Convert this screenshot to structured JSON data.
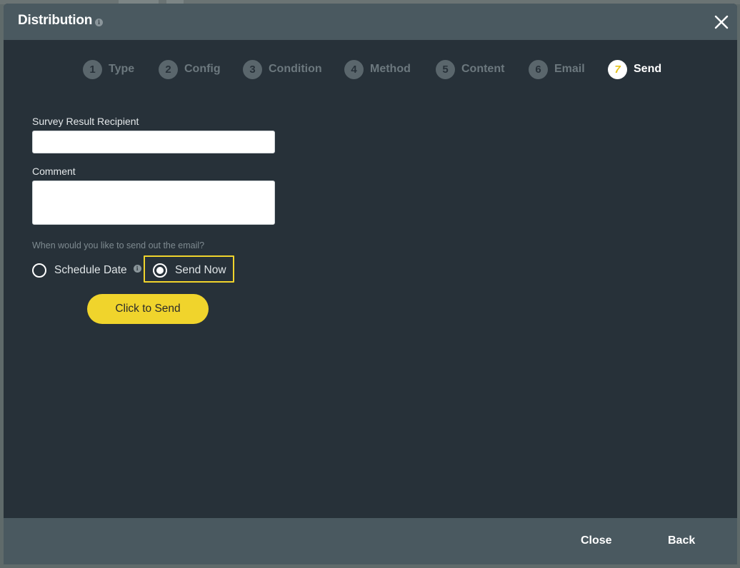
{
  "dialog": {
    "title": "Distribution",
    "title_info_icon": "info-icon",
    "close_icon": "close-icon"
  },
  "steps": [
    {
      "num": "1",
      "label": "Type",
      "active": false
    },
    {
      "num": "2",
      "label": "Config",
      "active": false
    },
    {
      "num": "3",
      "label": "Condition",
      "active": false
    },
    {
      "num": "4",
      "label": "Method",
      "active": false
    },
    {
      "num": "5",
      "label": "Content",
      "active": false
    },
    {
      "num": "6",
      "label": "Email",
      "active": false
    },
    {
      "num": "7",
      "label": "Send",
      "active": true
    }
  ],
  "form": {
    "recipient_label": "Survey Result Recipient",
    "recipient_value": "",
    "comment_label": "Comment",
    "comment_value": "",
    "question": "When would you like to send out the email?",
    "options": [
      {
        "label": "Schedule Date",
        "selected": false,
        "has_info": true
      },
      {
        "label": "Send Now",
        "selected": true,
        "has_info": false
      }
    ],
    "send_button": "Click to Send"
  },
  "footer": {
    "close_label": "Close",
    "back_label": "Back"
  },
  "colors": {
    "accent": "#f0d42c",
    "header_bg": "#4a5960",
    "body_bg": "#273139"
  }
}
